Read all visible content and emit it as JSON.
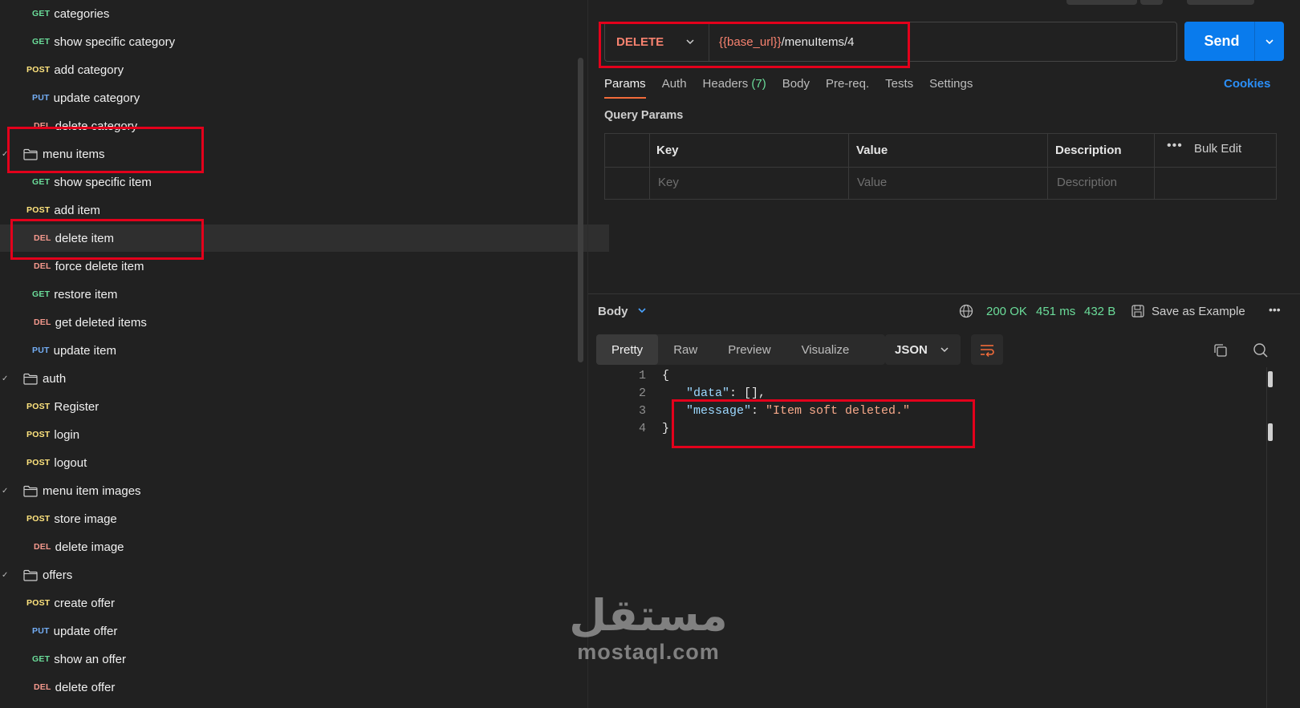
{
  "sidebar": {
    "items": [
      {
        "kind": "request",
        "method": "GET",
        "label": "categories",
        "indent": 1
      },
      {
        "kind": "request",
        "method": "GET",
        "label": "show specific category",
        "indent": 1
      },
      {
        "kind": "request",
        "method": "POST",
        "label": "add category",
        "indent": 1
      },
      {
        "kind": "request",
        "method": "PUT",
        "label": "update category",
        "indent": 1
      },
      {
        "kind": "request",
        "method": "DEL",
        "label": "delete category",
        "indent": 1
      },
      {
        "kind": "folder",
        "label": "menu items",
        "indent": 0
      },
      {
        "kind": "request",
        "method": "GET",
        "label": "show specific item",
        "indent": 1
      },
      {
        "kind": "request",
        "method": "POST",
        "label": "add item",
        "indent": 1
      },
      {
        "kind": "request",
        "method": "DEL",
        "label": "delete item",
        "indent": 1,
        "selected": true
      },
      {
        "kind": "request",
        "method": "DEL",
        "label": "force delete item",
        "indent": 1
      },
      {
        "kind": "request",
        "method": "GET",
        "label": "restore item",
        "indent": 1
      },
      {
        "kind": "request",
        "method": "DEL",
        "label": "get deleted items",
        "indent": 1
      },
      {
        "kind": "request",
        "method": "PUT",
        "label": "update item",
        "indent": 1
      },
      {
        "kind": "folder",
        "label": "auth",
        "indent": 0
      },
      {
        "kind": "request",
        "method": "POST",
        "label": "Register",
        "indent": 1
      },
      {
        "kind": "request",
        "method": "POST",
        "label": "login",
        "indent": 1
      },
      {
        "kind": "request",
        "method": "POST",
        "label": "logout",
        "indent": 1
      },
      {
        "kind": "folder",
        "label": "menu item images",
        "indent": 0
      },
      {
        "kind": "request",
        "method": "POST",
        "label": "store image",
        "indent": 1
      },
      {
        "kind": "request",
        "method": "DEL",
        "label": "delete image",
        "indent": 1
      },
      {
        "kind": "folder",
        "label": "offers",
        "indent": 0
      },
      {
        "kind": "request",
        "method": "POST",
        "label": "create offer",
        "indent": 1
      },
      {
        "kind": "request",
        "method": "PUT",
        "label": "update offer",
        "indent": 1
      },
      {
        "kind": "request",
        "method": "GET",
        "label": "show an offer",
        "indent": 1
      },
      {
        "kind": "request",
        "method": "DEL",
        "label": "delete offer",
        "indent": 1
      }
    ]
  },
  "request": {
    "method": "DELETE",
    "url_variable": "{{base_url}}",
    "url_path": "/menuItems/4",
    "send_label": "Send",
    "tabs": [
      {
        "label": "Params",
        "active": true
      },
      {
        "label": "Auth"
      },
      {
        "label": "Headers",
        "count": "(7)"
      },
      {
        "label": "Body"
      },
      {
        "label": "Pre-req."
      },
      {
        "label": "Tests"
      },
      {
        "label": "Settings"
      }
    ],
    "cookies_label": "Cookies",
    "query_params": {
      "title": "Query Params",
      "headers": {
        "key": "Key",
        "value": "Value",
        "description": "Description"
      },
      "placeholders": {
        "key": "Key",
        "value": "Value",
        "description": "Description"
      },
      "bulk_edit_label": "Bulk Edit"
    }
  },
  "response": {
    "body_label": "Body",
    "status": "200 OK",
    "time": "451 ms",
    "size": "432 B",
    "save_example_label": "Save as Example",
    "format_tabs": [
      {
        "label": "Pretty",
        "active": true
      },
      {
        "label": "Raw"
      },
      {
        "label": "Preview"
      },
      {
        "label": "Visualize"
      }
    ],
    "language": "JSON",
    "lines": [
      {
        "n": "1",
        "text": "{"
      },
      {
        "n": "2",
        "key": "\"data\"",
        "sep": ": ",
        "val": "[],"
      },
      {
        "n": "3",
        "key": "\"message\"",
        "sep": ": ",
        "str": "\"Item soft deleted.\""
      },
      {
        "n": "4",
        "text": "}"
      }
    ]
  },
  "watermark": {
    "arabic": "مستقل",
    "latin": "mostaql.com"
  },
  "colors": {
    "accent_send": "#097bed",
    "method_delete": "#f7826f",
    "method_get": "#6bdd9a",
    "method_post": "#ffe47e",
    "method_put": "#74aef6",
    "status_ok": "#6bdd9a",
    "highlight": "#e3001b"
  }
}
